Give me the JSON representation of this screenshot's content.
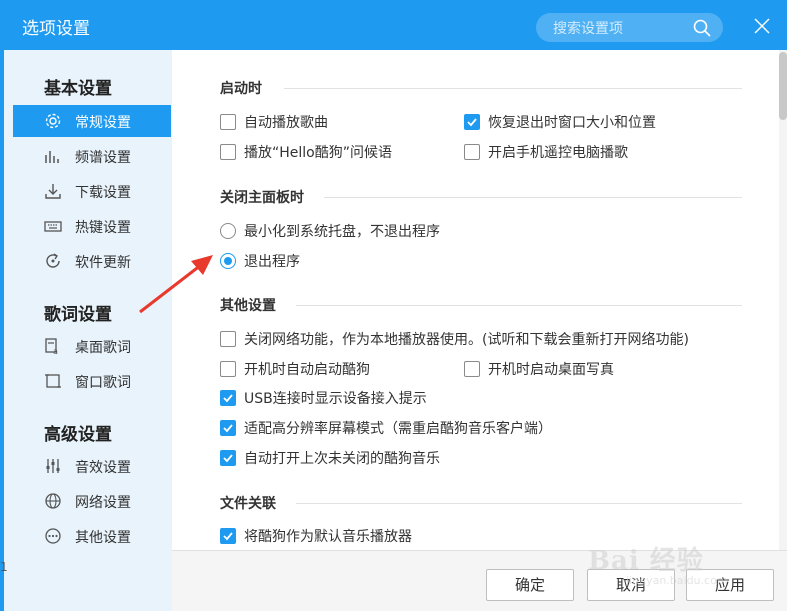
{
  "window": {
    "title": "选项设置",
    "search_placeholder": "搜索设置项"
  },
  "sidebar": {
    "sections": [
      {
        "title": "基本设置",
        "items": [
          {
            "label": "常规设置",
            "icon": "gear-icon",
            "active": true
          },
          {
            "label": "频谱设置",
            "icon": "spectrum-icon"
          },
          {
            "label": "下载设置",
            "icon": "download-icon"
          },
          {
            "label": "热键设置",
            "icon": "keyboard-icon"
          },
          {
            "label": "软件更新",
            "icon": "update-icon"
          }
        ]
      },
      {
        "title": "歌词设置",
        "items": [
          {
            "label": "桌面歌词",
            "icon": "desktop-lyrics-icon"
          },
          {
            "label": "窗口歌词",
            "icon": "window-lyrics-icon"
          }
        ]
      },
      {
        "title": "高级设置",
        "items": [
          {
            "label": "音效设置",
            "icon": "equalizer-icon"
          },
          {
            "label": "网络设置",
            "icon": "network-icon"
          },
          {
            "label": "其他设置",
            "icon": "more-icon"
          }
        ]
      }
    ]
  },
  "groups": {
    "startup": {
      "title": "启动时",
      "options": [
        {
          "label": "自动播放歌曲",
          "checked": false
        },
        {
          "label": "恢复退出时窗口大小和位置",
          "checked": true
        },
        {
          "label": "播放“Hello酷狗”问候语",
          "checked": false
        },
        {
          "label": "开启手机遥控电脑播歌",
          "checked": false
        }
      ]
    },
    "close_panel": {
      "title": "关闭主面板时",
      "options": [
        {
          "label": "最小化到系统托盘，不退出程序",
          "selected": false
        },
        {
          "label": "退出程序",
          "selected": true
        }
      ]
    },
    "other": {
      "title": "其他设置",
      "options": [
        {
          "label": "关闭网络功能，作为本地播放器使用。(试听和下载会重新打开网络功能)",
          "checked": false
        },
        {
          "label": "开机时自动启动酷狗",
          "checked": false
        },
        {
          "label": "开机时启动桌面写真",
          "checked": false
        },
        {
          "label": "USB连接时显示设备接入提示",
          "checked": true
        },
        {
          "label": "适配高分辨率屏幕模式（需重启酷狗音乐客户端）",
          "checked": true
        },
        {
          "label": "自动打开上次未关闭的酷狗音乐",
          "checked": true
        }
      ]
    },
    "file_assoc": {
      "title": "文件关联",
      "options": [
        {
          "label": "将酷狗作为默认音乐播放器",
          "checked": true
        }
      ]
    }
  },
  "footer": {
    "ok_label": "确定",
    "cancel_label": "取消",
    "apply_label": "应用"
  },
  "watermark": {
    "text": "Bai 经验",
    "url": "jingyan.baidu.com"
  },
  "edge_char": "1",
  "colors": {
    "accent": "#1e9bf0",
    "sidebar_bg": "#e8f3fb",
    "annotation_arrow": "#e8392d"
  }
}
